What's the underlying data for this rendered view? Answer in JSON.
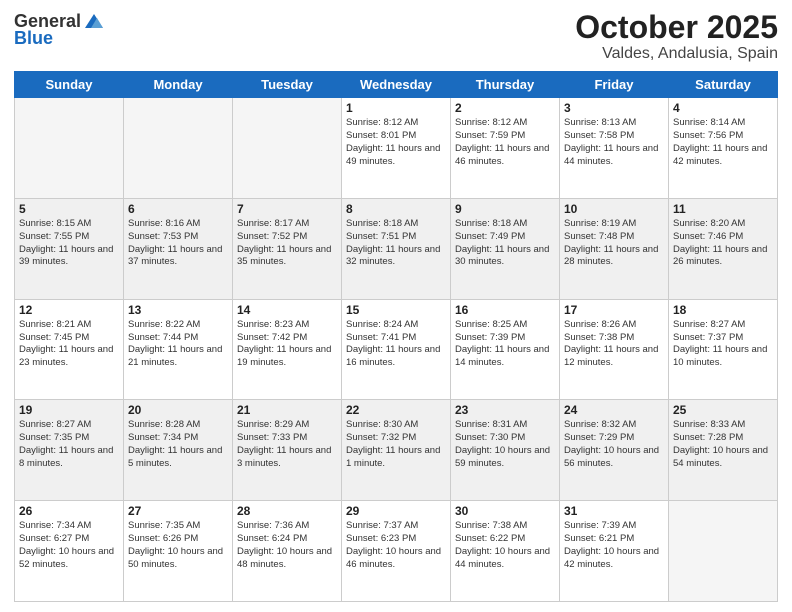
{
  "header": {
    "logo_general": "General",
    "logo_blue": "Blue",
    "month": "October 2025",
    "location": "Valdes, Andalusia, Spain"
  },
  "days_of_week": [
    "Sunday",
    "Monday",
    "Tuesday",
    "Wednesday",
    "Thursday",
    "Friday",
    "Saturday"
  ],
  "weeks": [
    [
      {
        "day": "",
        "sunrise": "",
        "sunset": "",
        "daylight": ""
      },
      {
        "day": "",
        "sunrise": "",
        "sunset": "",
        "daylight": ""
      },
      {
        "day": "",
        "sunrise": "",
        "sunset": "",
        "daylight": ""
      },
      {
        "day": "1",
        "sunrise": "Sunrise: 8:12 AM",
        "sunset": "Sunset: 8:01 PM",
        "daylight": "Daylight: 11 hours and 49 minutes."
      },
      {
        "day": "2",
        "sunrise": "Sunrise: 8:12 AM",
        "sunset": "Sunset: 7:59 PM",
        "daylight": "Daylight: 11 hours and 46 minutes."
      },
      {
        "day": "3",
        "sunrise": "Sunrise: 8:13 AM",
        "sunset": "Sunset: 7:58 PM",
        "daylight": "Daylight: 11 hours and 44 minutes."
      },
      {
        "day": "4",
        "sunrise": "Sunrise: 8:14 AM",
        "sunset": "Sunset: 7:56 PM",
        "daylight": "Daylight: 11 hours and 42 minutes."
      }
    ],
    [
      {
        "day": "5",
        "sunrise": "Sunrise: 8:15 AM",
        "sunset": "Sunset: 7:55 PM",
        "daylight": "Daylight: 11 hours and 39 minutes."
      },
      {
        "day": "6",
        "sunrise": "Sunrise: 8:16 AM",
        "sunset": "Sunset: 7:53 PM",
        "daylight": "Daylight: 11 hours and 37 minutes."
      },
      {
        "day": "7",
        "sunrise": "Sunrise: 8:17 AM",
        "sunset": "Sunset: 7:52 PM",
        "daylight": "Daylight: 11 hours and 35 minutes."
      },
      {
        "day": "8",
        "sunrise": "Sunrise: 8:18 AM",
        "sunset": "Sunset: 7:51 PM",
        "daylight": "Daylight: 11 hours and 32 minutes."
      },
      {
        "day": "9",
        "sunrise": "Sunrise: 8:18 AM",
        "sunset": "Sunset: 7:49 PM",
        "daylight": "Daylight: 11 hours and 30 minutes."
      },
      {
        "day": "10",
        "sunrise": "Sunrise: 8:19 AM",
        "sunset": "Sunset: 7:48 PM",
        "daylight": "Daylight: 11 hours and 28 minutes."
      },
      {
        "day": "11",
        "sunrise": "Sunrise: 8:20 AM",
        "sunset": "Sunset: 7:46 PM",
        "daylight": "Daylight: 11 hours and 26 minutes."
      }
    ],
    [
      {
        "day": "12",
        "sunrise": "Sunrise: 8:21 AM",
        "sunset": "Sunset: 7:45 PM",
        "daylight": "Daylight: 11 hours and 23 minutes."
      },
      {
        "day": "13",
        "sunrise": "Sunrise: 8:22 AM",
        "sunset": "Sunset: 7:44 PM",
        "daylight": "Daylight: 11 hours and 21 minutes."
      },
      {
        "day": "14",
        "sunrise": "Sunrise: 8:23 AM",
        "sunset": "Sunset: 7:42 PM",
        "daylight": "Daylight: 11 hours and 19 minutes."
      },
      {
        "day": "15",
        "sunrise": "Sunrise: 8:24 AM",
        "sunset": "Sunset: 7:41 PM",
        "daylight": "Daylight: 11 hours and 16 minutes."
      },
      {
        "day": "16",
        "sunrise": "Sunrise: 8:25 AM",
        "sunset": "Sunset: 7:39 PM",
        "daylight": "Daylight: 11 hours and 14 minutes."
      },
      {
        "day": "17",
        "sunrise": "Sunrise: 8:26 AM",
        "sunset": "Sunset: 7:38 PM",
        "daylight": "Daylight: 11 hours and 12 minutes."
      },
      {
        "day": "18",
        "sunrise": "Sunrise: 8:27 AM",
        "sunset": "Sunset: 7:37 PM",
        "daylight": "Daylight: 11 hours and 10 minutes."
      }
    ],
    [
      {
        "day": "19",
        "sunrise": "Sunrise: 8:27 AM",
        "sunset": "Sunset: 7:35 PM",
        "daylight": "Daylight: 11 hours and 8 minutes."
      },
      {
        "day": "20",
        "sunrise": "Sunrise: 8:28 AM",
        "sunset": "Sunset: 7:34 PM",
        "daylight": "Daylight: 11 hours and 5 minutes."
      },
      {
        "day": "21",
        "sunrise": "Sunrise: 8:29 AM",
        "sunset": "Sunset: 7:33 PM",
        "daylight": "Daylight: 11 hours and 3 minutes."
      },
      {
        "day": "22",
        "sunrise": "Sunrise: 8:30 AM",
        "sunset": "Sunset: 7:32 PM",
        "daylight": "Daylight: 11 hours and 1 minute."
      },
      {
        "day": "23",
        "sunrise": "Sunrise: 8:31 AM",
        "sunset": "Sunset: 7:30 PM",
        "daylight": "Daylight: 10 hours and 59 minutes."
      },
      {
        "day": "24",
        "sunrise": "Sunrise: 8:32 AM",
        "sunset": "Sunset: 7:29 PM",
        "daylight": "Daylight: 10 hours and 56 minutes."
      },
      {
        "day": "25",
        "sunrise": "Sunrise: 8:33 AM",
        "sunset": "Sunset: 7:28 PM",
        "daylight": "Daylight: 10 hours and 54 minutes."
      }
    ],
    [
      {
        "day": "26",
        "sunrise": "Sunrise: 7:34 AM",
        "sunset": "Sunset: 6:27 PM",
        "daylight": "Daylight: 10 hours and 52 minutes."
      },
      {
        "day": "27",
        "sunrise": "Sunrise: 7:35 AM",
        "sunset": "Sunset: 6:26 PM",
        "daylight": "Daylight: 10 hours and 50 minutes."
      },
      {
        "day": "28",
        "sunrise": "Sunrise: 7:36 AM",
        "sunset": "Sunset: 6:24 PM",
        "daylight": "Daylight: 10 hours and 48 minutes."
      },
      {
        "day": "29",
        "sunrise": "Sunrise: 7:37 AM",
        "sunset": "Sunset: 6:23 PM",
        "daylight": "Daylight: 10 hours and 46 minutes."
      },
      {
        "day": "30",
        "sunrise": "Sunrise: 7:38 AM",
        "sunset": "Sunset: 6:22 PM",
        "daylight": "Daylight: 10 hours and 44 minutes."
      },
      {
        "day": "31",
        "sunrise": "Sunrise: 7:39 AM",
        "sunset": "Sunset: 6:21 PM",
        "daylight": "Daylight: 10 hours and 42 minutes."
      },
      {
        "day": "",
        "sunrise": "",
        "sunset": "",
        "daylight": ""
      }
    ]
  ]
}
